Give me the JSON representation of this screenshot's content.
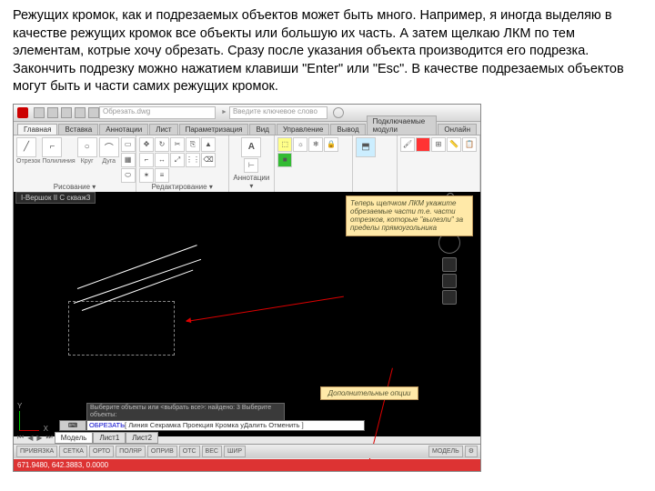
{
  "intro": "Режущих кромок, как и подрезаемых объектов может быть много. Например, я иногда выделяю в качестве режущих кромок все объекты или большую их часть. А затем щелкаю ЛКМ по тем элементам, котрые хочу обрезать. Сразу после указания объекта производится его подрезка. Закончить подрезку можно нажатием клавиши \"Enter\" или \"Esc\". В качестве подрезаемых объектов могут быть и части самих режущих кромок.",
  "title_hint": "Обрезать.dwg",
  "search_ph": "Введите ключевое слово",
  "tabs": [
    "Главная",
    "Вставка",
    "Аннотации",
    "Лист",
    "Параметризация",
    "Вид",
    "Управление",
    "Вывод",
    "Подключаемые модули",
    "Онлайн"
  ],
  "panel_draw": [
    "Отрезок",
    "Полилиния",
    "Круг",
    "Дуга"
  ],
  "panel_draw_name": "Рисование ▾",
  "panel_mod_name": "Редактирование ▾",
  "annot_name": "Аннотации ▾",
  "view_label": "I-Вершок II С скваж3",
  "callout1": "Теперь щелчком ЛКМ укажите обрезаемые части т.е. части отрезков, которые \"вылезли\" за пределы прямоугольника",
  "callout2": "Дополнительные опции",
  "cmd_hist": "Выберите объекты или <выбрать все>: найдено: 3\nВыберите объекты:",
  "cmd_line_prefix": "ОБРЕЗАТЬ",
  "cmd_line_opts": " [ Линия Секрамка Проекция Кромка уДалить Отменить ]",
  "model_tabs": [
    "Модель",
    "Лист1",
    "Лист2"
  ],
  "status_btns": [
    "ПРИВЯЗКА",
    "СЕТКА",
    "ОРТО",
    "ПОЛЯР",
    "ОПРИВ",
    "ОТС",
    "ВЕС",
    "ШИР"
  ],
  "coords": "671.9480, 642.3883, 0.0000",
  "axis": {
    "y": "Y",
    "x": "X"
  }
}
